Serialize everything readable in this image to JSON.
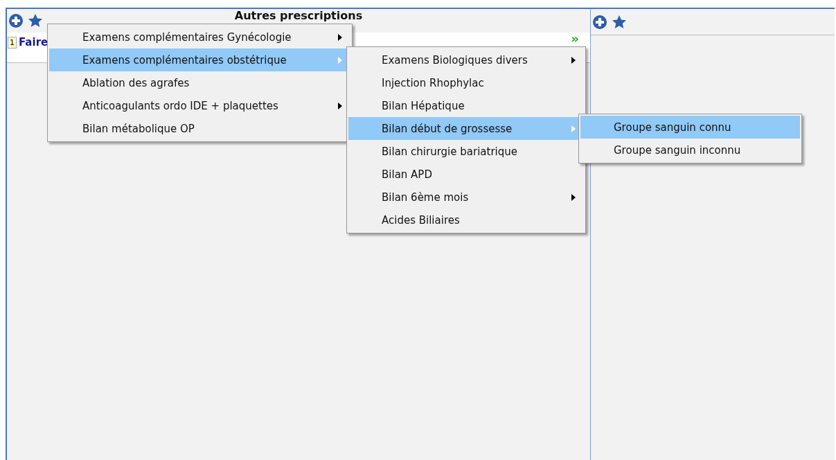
{
  "left_panel": {
    "title": "Autres prescriptions",
    "row": {
      "number": "1",
      "label": "Faire",
      "more": "»"
    }
  },
  "menus": [
    {
      "items": [
        {
          "label": "Examens complémentaires Gynécologie",
          "selected": false,
          "submenu": true
        },
        {
          "label": "Examens complémentaires obstétrique",
          "selected": true,
          "submenu": true
        },
        {
          "label": "Ablation des agrafes",
          "selected": false,
          "submenu": false
        },
        {
          "label": "Anticoagulants ordo IDE + plaquettes",
          "selected": false,
          "submenu": true
        },
        {
          "label": "Bilan métabolique OP",
          "selected": false,
          "submenu": false
        }
      ]
    },
    {
      "items": [
        {
          "label": "Examens Biologiques divers",
          "selected": false,
          "submenu": true
        },
        {
          "label": "Injection Rhophylac",
          "selected": false,
          "submenu": false
        },
        {
          "label": "Bilan Hépatique",
          "selected": false,
          "submenu": false
        },
        {
          "label": "Bilan début de grossesse",
          "selected": true,
          "submenu": true
        },
        {
          "label": "Bilan chirurgie bariatrique",
          "selected": false,
          "submenu": false
        },
        {
          "label": "Bilan APD",
          "selected": false,
          "submenu": false
        },
        {
          "label": "Bilan 6ème mois",
          "selected": false,
          "submenu": true
        },
        {
          "label": "Acides Biliaires",
          "selected": false,
          "submenu": false
        }
      ]
    },
    {
      "items": [
        {
          "label": "Groupe sanguin connu",
          "selected": true,
          "submenu": false
        },
        {
          "label": "Groupe sanguin inconnu",
          "selected": false,
          "submenu": false
        }
      ]
    }
  ]
}
